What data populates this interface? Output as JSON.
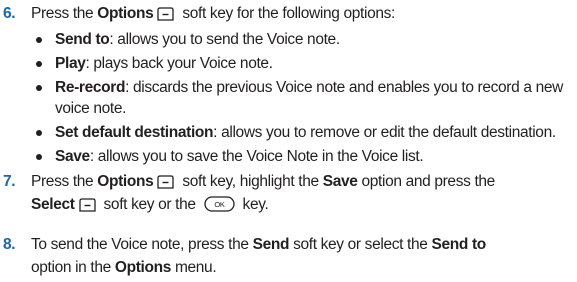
{
  "step6": {
    "num": "6.",
    "pre": "Press the ",
    "bold1": "Options",
    "post": " soft key for the following options:"
  },
  "bullets": [
    {
      "bold": "Send to",
      "text": ": allows you to send the Voice note."
    },
    {
      "bold": "Play",
      "text": ": plays back your Voice note."
    },
    {
      "bold": "Re-record",
      "text": ": discards the previous Voice note and enables you to record a new",
      "cont": "voice note."
    },
    {
      "bold": "Set default destination",
      "text": ": allows you to remove or edit the default destination."
    },
    {
      "bold": "Save",
      "text": ": allows you to save the Voice Note in the Voice list."
    }
  ],
  "step7": {
    "num": "7.",
    "p1": "Press the ",
    "b1": "Options",
    "p2": " soft key, highlight the ",
    "b2": "Save",
    "p3": " option and press the",
    "b3": "Select",
    "p4": " soft key or the ",
    "p5": " key."
  },
  "step8": {
    "num": "8.",
    "p1": "To send the Voice note, press the ",
    "b1": "Send",
    "p2": " soft key or select the ",
    "b2": "Send to",
    "l2a": "option in the ",
    "b3": "Options",
    "l2b": " menu."
  },
  "icons": {
    "softkey": "soft-key-icon",
    "ok": "ok-key-icon",
    "ok_label": "OK"
  },
  "colors": {
    "step_number": "#1b66a9",
    "text": "#231f20"
  }
}
